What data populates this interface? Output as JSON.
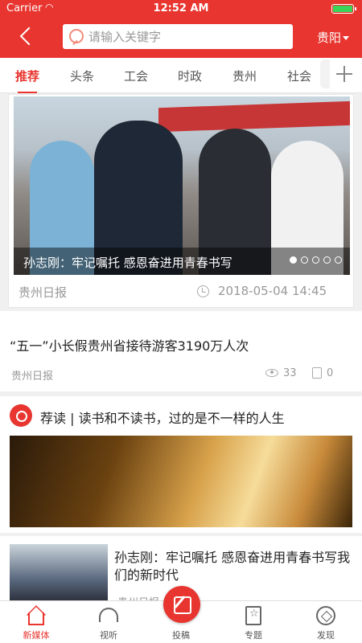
{
  "status": {
    "carrier": "Carrier",
    "time": "12:52 AM"
  },
  "header": {
    "search_placeholder": "请输入关键字",
    "city": "贵阳"
  },
  "tabs": [
    {
      "label": "推荐",
      "active": true
    },
    {
      "label": "头条"
    },
    {
      "label": "工会"
    },
    {
      "label": "时政"
    },
    {
      "label": "贵州"
    },
    {
      "label": "社会"
    }
  ],
  "feed": {
    "hero": {
      "caption": "孙志刚：牢记嘱托 感恩奋进用青春书写",
      "source": "贵州日报",
      "date": "2018-05-04 14:45",
      "slide_count": 5,
      "active_slide": 1
    },
    "article1": {
      "title": "“五一”小长假贵州省接待游客3190万人次",
      "source": "贵州日报",
      "views": "33",
      "likes": "0"
    },
    "article2": {
      "title": "荐读 | 读书和不读书，过的是不一样的人生"
    },
    "article3": {
      "title": "孙志刚：牢记嘱托 感恩奋进用青春书写我们的新时代",
      "source": "贵州日报"
    }
  },
  "bottom_nav": [
    {
      "label": "新媒体",
      "icon": "home-icon",
      "active": true
    },
    {
      "label": "视听",
      "icon": "headphones-icon"
    },
    {
      "label": "投稿",
      "icon": "compose-icon"
    },
    {
      "label": "专题",
      "icon": "topic-icon"
    },
    {
      "label": "发现",
      "icon": "compass-icon"
    }
  ],
  "colors": {
    "brand": "#e8352f"
  }
}
